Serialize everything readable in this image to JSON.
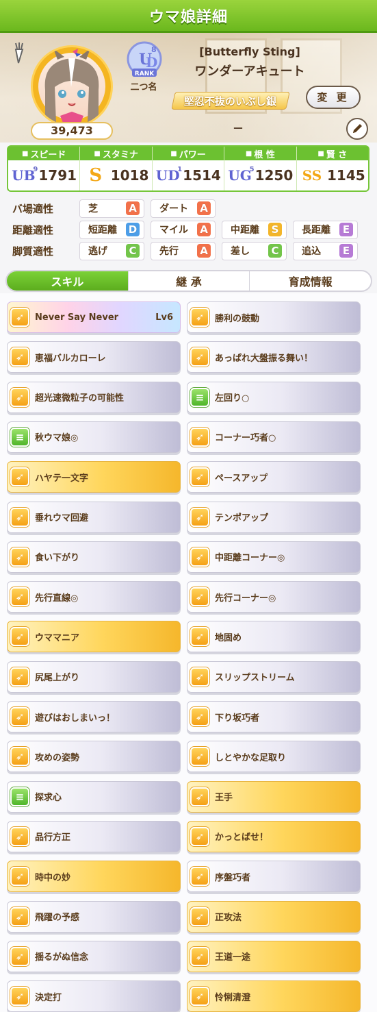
{
  "header": {
    "title": "ウマ娘詳細",
    "fans": "39,473",
    "rank_badge": {
      "grade": "UD",
      "sub": "8",
      "word": "RANK"
    },
    "rank_label": "二つ名",
    "epithet": "[Butterfly Sting]",
    "character_name": "ワンダーアキュート",
    "title_plate": "堅忍不抜のいぶし銀",
    "change_button": "変 更",
    "subtitle": "－"
  },
  "stats": [
    {
      "label": "スピード",
      "icon": "shoe-icon",
      "grade": "UB",
      "grade_sub": "9",
      "value": "1791"
    },
    {
      "label": "スタミナ",
      "icon": "heart-icon",
      "grade": "S",
      "grade_sub": "",
      "value": "1018"
    },
    {
      "label": "パワー",
      "icon": "muscle-icon",
      "grade": "UD",
      "grade_sub": "1",
      "value": "1514"
    },
    {
      "label": "根 性",
      "icon": "flame-icon",
      "grade": "UG",
      "grade_sub": "5",
      "value": "1250"
    },
    {
      "label": "賢 さ",
      "icon": "grad-cap-icon",
      "grade": "SS",
      "grade_sub": "",
      "value": "1145"
    }
  ],
  "aptitudes": [
    {
      "label": "バ場適性",
      "items": [
        {
          "name": "芝",
          "grade": "A"
        },
        {
          "name": "ダート",
          "grade": "A"
        }
      ]
    },
    {
      "label": "距離適性",
      "items": [
        {
          "name": "短距離",
          "grade": "D"
        },
        {
          "name": "マイル",
          "grade": "A"
        },
        {
          "name": "中距離",
          "grade": "S"
        },
        {
          "name": "長距離",
          "grade": "E"
        }
      ]
    },
    {
      "label": "脚質適性",
      "items": [
        {
          "name": "逃げ",
          "grade": "C"
        },
        {
          "name": "先行",
          "grade": "A"
        },
        {
          "name": "差し",
          "grade": "C"
        },
        {
          "name": "追込",
          "grade": "E"
        }
      ]
    }
  ],
  "grade_colors": {
    "S": "#f3b52a",
    "A": "#f2714a",
    "B": "#f06aa0",
    "C": "#73c54a",
    "D": "#4d9ee8",
    "E": "#b77bd6"
  },
  "tabs": [
    "スキル",
    "継 承",
    "育成情報"
  ],
  "active_tab": "スキル",
  "skills": [
    {
      "name": "Never Say Never",
      "level": "Lv6",
      "style": "rainbow",
      "icon": "speed"
    },
    {
      "name": "勝利の鼓動",
      "style": "normal",
      "icon": "speed"
    },
    {
      "name": "恵福バルカローレ",
      "style": "normal",
      "icon": "speed"
    },
    {
      "name": "あっぱれ大盤振る舞い！",
      "style": "normal",
      "icon": "speed"
    },
    {
      "name": "超光速微粒子の可能性",
      "style": "normal",
      "icon": "speed"
    },
    {
      "name": "左回り○",
      "style": "normal",
      "icon": "green"
    },
    {
      "name": "秋ウマ娘◎",
      "style": "normal",
      "icon": "green"
    },
    {
      "name": "コーナー巧者○",
      "style": "normal",
      "icon": "speed"
    },
    {
      "name": "ハヤテ一文字",
      "style": "gold",
      "icon": "speed"
    },
    {
      "name": "ペースアップ",
      "style": "normal",
      "icon": "speed"
    },
    {
      "name": "垂れウマ回避",
      "style": "normal",
      "icon": "speed"
    },
    {
      "name": "テンポアップ",
      "style": "normal",
      "icon": "speed"
    },
    {
      "name": "食い下がり",
      "style": "normal",
      "icon": "speed"
    },
    {
      "name": "中距離コーナー◎",
      "style": "normal",
      "icon": "speed"
    },
    {
      "name": "先行直線◎",
      "style": "normal",
      "icon": "speed"
    },
    {
      "name": "先行コーナー◎",
      "style": "normal",
      "icon": "speed"
    },
    {
      "name": "ウママニア",
      "style": "gold",
      "icon": "speed"
    },
    {
      "name": "地固め",
      "style": "normal",
      "icon": "speed"
    },
    {
      "name": "尻尾上がり",
      "style": "normal",
      "icon": "speed"
    },
    {
      "name": "スリップストリーム",
      "style": "normal",
      "icon": "speed"
    },
    {
      "name": "遊びはおしまいっ！",
      "style": "normal",
      "icon": "speed"
    },
    {
      "name": "下り坂巧者",
      "style": "normal",
      "icon": "speed"
    },
    {
      "name": "攻めの姿勢",
      "style": "normal",
      "icon": "speed"
    },
    {
      "name": "しとやかな足取り",
      "style": "normal",
      "icon": "speed"
    },
    {
      "name": "探求心",
      "style": "normal",
      "icon": "green"
    },
    {
      "name": "王手",
      "style": "gold",
      "icon": "speed"
    },
    {
      "name": "品行方正",
      "style": "normal",
      "icon": "speed"
    },
    {
      "name": "かっとばせ！",
      "style": "gold",
      "icon": "speed"
    },
    {
      "name": "時中の妙",
      "style": "gold",
      "icon": "speed"
    },
    {
      "name": "序盤巧者",
      "style": "normal",
      "icon": "speed"
    },
    {
      "name": "飛躍の予感",
      "style": "normal",
      "icon": "speed"
    },
    {
      "name": "正攻法",
      "style": "gold",
      "icon": "speed"
    },
    {
      "name": "揺るがぬ信念",
      "style": "normal",
      "icon": "speed"
    },
    {
      "name": "王道一途",
      "style": "gold",
      "icon": "speed"
    },
    {
      "name": "決定打",
      "style": "normal",
      "icon": "speed"
    },
    {
      "name": "怜悧清澄",
      "style": "gold",
      "icon": "speed"
    }
  ]
}
